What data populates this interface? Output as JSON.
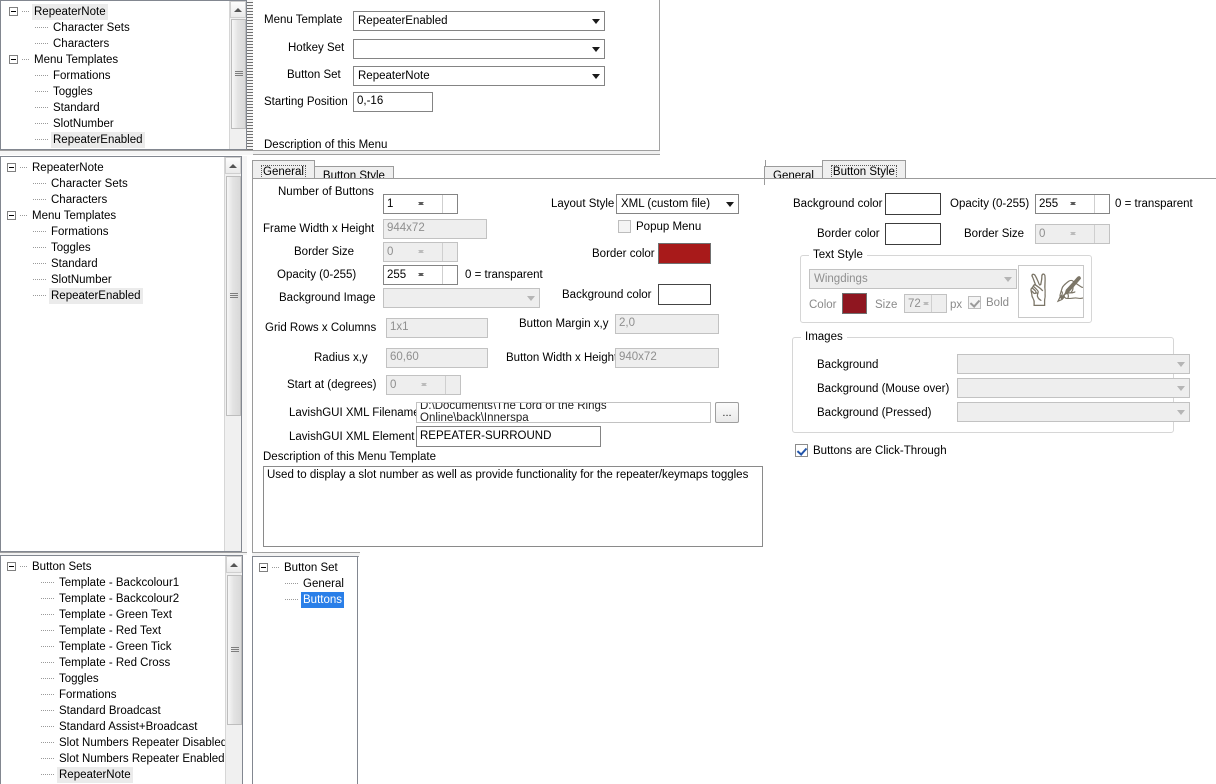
{
  "top_panel": {
    "fields": [
      {
        "label": "Menu Template",
        "value": "RepeaterEnabled",
        "type": "combo"
      },
      {
        "label": "Hotkey Set",
        "value": "",
        "type": "combo"
      },
      {
        "label": "Button Set",
        "value": "RepeaterNote",
        "type": "combo"
      },
      {
        "label": "Starting Position",
        "value": "0,-16",
        "type": "text"
      }
    ],
    "description_label": "Description of this Menu"
  },
  "tree_top": {
    "nodes": [
      {
        "label": "RepeaterNote",
        "depth": 0,
        "expander": true,
        "state": "selected-grey"
      },
      {
        "label": "Character Sets",
        "depth": 1,
        "expander": false,
        "state": "none"
      },
      {
        "label": "Characters",
        "depth": 1,
        "expander": false,
        "state": "none"
      },
      {
        "label": "Menu Templates",
        "depth": 0,
        "expander": true,
        "state": "none"
      },
      {
        "label": "Formations",
        "depth": 1,
        "expander": false,
        "state": "none"
      },
      {
        "label": "Toggles",
        "depth": 1,
        "expander": false,
        "state": "none"
      },
      {
        "label": "Standard",
        "depth": 1,
        "expander": false,
        "state": "none"
      },
      {
        "label": "SlotNumber",
        "depth": 1,
        "expander": false,
        "state": "none"
      },
      {
        "label": "RepeaterEnabled",
        "depth": 1,
        "expander": false,
        "state": "selected-grey"
      }
    ]
  },
  "tree_middle": {
    "nodes": [
      {
        "label": "RepeaterNote",
        "depth": 0,
        "expander": true,
        "state": "none"
      },
      {
        "label": "Character Sets",
        "depth": 1,
        "expander": false,
        "state": "none"
      },
      {
        "label": "Characters",
        "depth": 1,
        "expander": false,
        "state": "none"
      },
      {
        "label": "Menu Templates",
        "depth": 0,
        "expander": true,
        "state": "none"
      },
      {
        "label": "Formations",
        "depth": 1,
        "expander": false,
        "state": "none"
      },
      {
        "label": "Toggles",
        "depth": 1,
        "expander": false,
        "state": "none"
      },
      {
        "label": "Standard",
        "depth": 1,
        "expander": false,
        "state": "none"
      },
      {
        "label": "SlotNumber",
        "depth": 1,
        "expander": false,
        "state": "none"
      },
      {
        "label": "RepeaterEnabled",
        "depth": 1,
        "expander": false,
        "state": "selected-grey"
      }
    ]
  },
  "tree_bottom_left": {
    "nodes": [
      {
        "label": "Button Sets",
        "depth": 0,
        "expander": true,
        "state": "none"
      },
      {
        "label": "Template - Backcolour1",
        "depth": 1,
        "expander": false,
        "state": "none"
      },
      {
        "label": "Template - Backcolour2",
        "depth": 1,
        "expander": false,
        "state": "none"
      },
      {
        "label": "Template - Green Text",
        "depth": 1,
        "expander": false,
        "state": "none"
      },
      {
        "label": "Template - Red Text",
        "depth": 1,
        "expander": false,
        "state": "none"
      },
      {
        "label": "Template - Green Tick",
        "depth": 1,
        "expander": false,
        "state": "none"
      },
      {
        "label": "Template - Red Cross",
        "depth": 1,
        "expander": false,
        "state": "none"
      },
      {
        "label": "Toggles",
        "depth": 1,
        "expander": false,
        "state": "none"
      },
      {
        "label": "Formations",
        "depth": 1,
        "expander": false,
        "state": "none"
      },
      {
        "label": "Standard Broadcast",
        "depth": 1,
        "expander": false,
        "state": "none"
      },
      {
        "label": "Standard Assist+Broadcast",
        "depth": 1,
        "expander": false,
        "state": "none"
      },
      {
        "label": "Slot Numbers Repeater Disabled",
        "depth": 1,
        "expander": false,
        "state": "none"
      },
      {
        "label": "Slot Numbers Repeater Enabled",
        "depth": 1,
        "expander": false,
        "state": "none"
      },
      {
        "label": "RepeaterNote",
        "depth": 1,
        "expander": false,
        "state": "selected-grey"
      }
    ]
  },
  "tree_bottom_middle": {
    "nodes": [
      {
        "label": "Button Set",
        "depth": 0,
        "expander": true,
        "state": "none"
      },
      {
        "label": "General",
        "depth": 1,
        "expander": false,
        "state": "none"
      },
      {
        "label": "Buttons",
        "depth": 1,
        "expander": false,
        "state": "selected-blue"
      }
    ]
  },
  "left_tabs": {
    "general": "General",
    "button_style": "Button Style",
    "active": "General"
  },
  "right_tabs": {
    "general": "General",
    "button_style": "Button Style",
    "active": "Button Style"
  },
  "general_tab": {
    "number_of_buttons_label": "Number of Buttons",
    "number_of_buttons_value": "1",
    "frame_wh_label": "Frame Width x Height",
    "frame_wh_value": "944x72",
    "border_size_label": "Border Size",
    "border_size_value": "0",
    "opacity_label": "Opacity (0-255)",
    "opacity_value": "255",
    "opacity_hint": "0 = transparent",
    "background_image_label": "Background Image",
    "background_image_value": "",
    "grid_rows_cols_label": "Grid Rows x Columns",
    "grid_rows_cols_value": "1x1",
    "radius_label": "Radius x,y",
    "radius_value": "60,60",
    "start_at_label": "Start at (degrees)",
    "start_at_value": "0",
    "layout_style_label": "Layout Style",
    "layout_style_value": "XML (custom file)",
    "popup_menu_label": "Popup Menu",
    "popup_menu_checked": false,
    "border_color_label": "Border color",
    "border_color_value": "#a81a1a",
    "background_color_label": "Background color",
    "background_color_value": "#ffffff",
    "button_margin_label": "Button Margin x,y",
    "button_margin_value": "2,0",
    "button_wh_label": "Button Width x Height",
    "button_wh_value": "940x72",
    "xml_filename_label": "LavishGUI XML Filename",
    "xml_filename_value": "D:\\Documents\\The Lord of the Rings Online\\back\\Innerspa",
    "browse_button_label": "...",
    "xml_element_label": "LavishGUI XML Element",
    "xml_element_value": "REPEATER-SURROUND",
    "description_label": "Description of this Menu Template",
    "description_value": "Used to display a slot number as well as provide functionality for the repeater/keymaps toggles"
  },
  "button_style_tab": {
    "background_color_label": "Background color",
    "background_color_value": "#ffffff",
    "opacity_label": "Opacity (0-255)",
    "opacity_value": "255",
    "opacity_hint": "0 = transparent",
    "border_color_label": "Border color",
    "border_color_value": "#ffffff",
    "border_size_label": "Border Size",
    "border_size_value": "0",
    "text_style_group": "Text Style",
    "font_value": "Wingdings",
    "color_label": "Color",
    "color_value": "#8f1620",
    "size_label": "Size",
    "size_value": "72",
    "size_unit": "px",
    "bold_label": "Bold",
    "bold_checked": true,
    "preview_glyph": "✌✍",
    "images_group": "Images",
    "images": [
      {
        "label": "Background",
        "value": ""
      },
      {
        "label": "Background (Mouse over)",
        "value": ""
      },
      {
        "label": "Background (Pressed)",
        "value": ""
      }
    ],
    "click_through_label": "Buttons are Click-Through",
    "click_through_checked": true
  }
}
